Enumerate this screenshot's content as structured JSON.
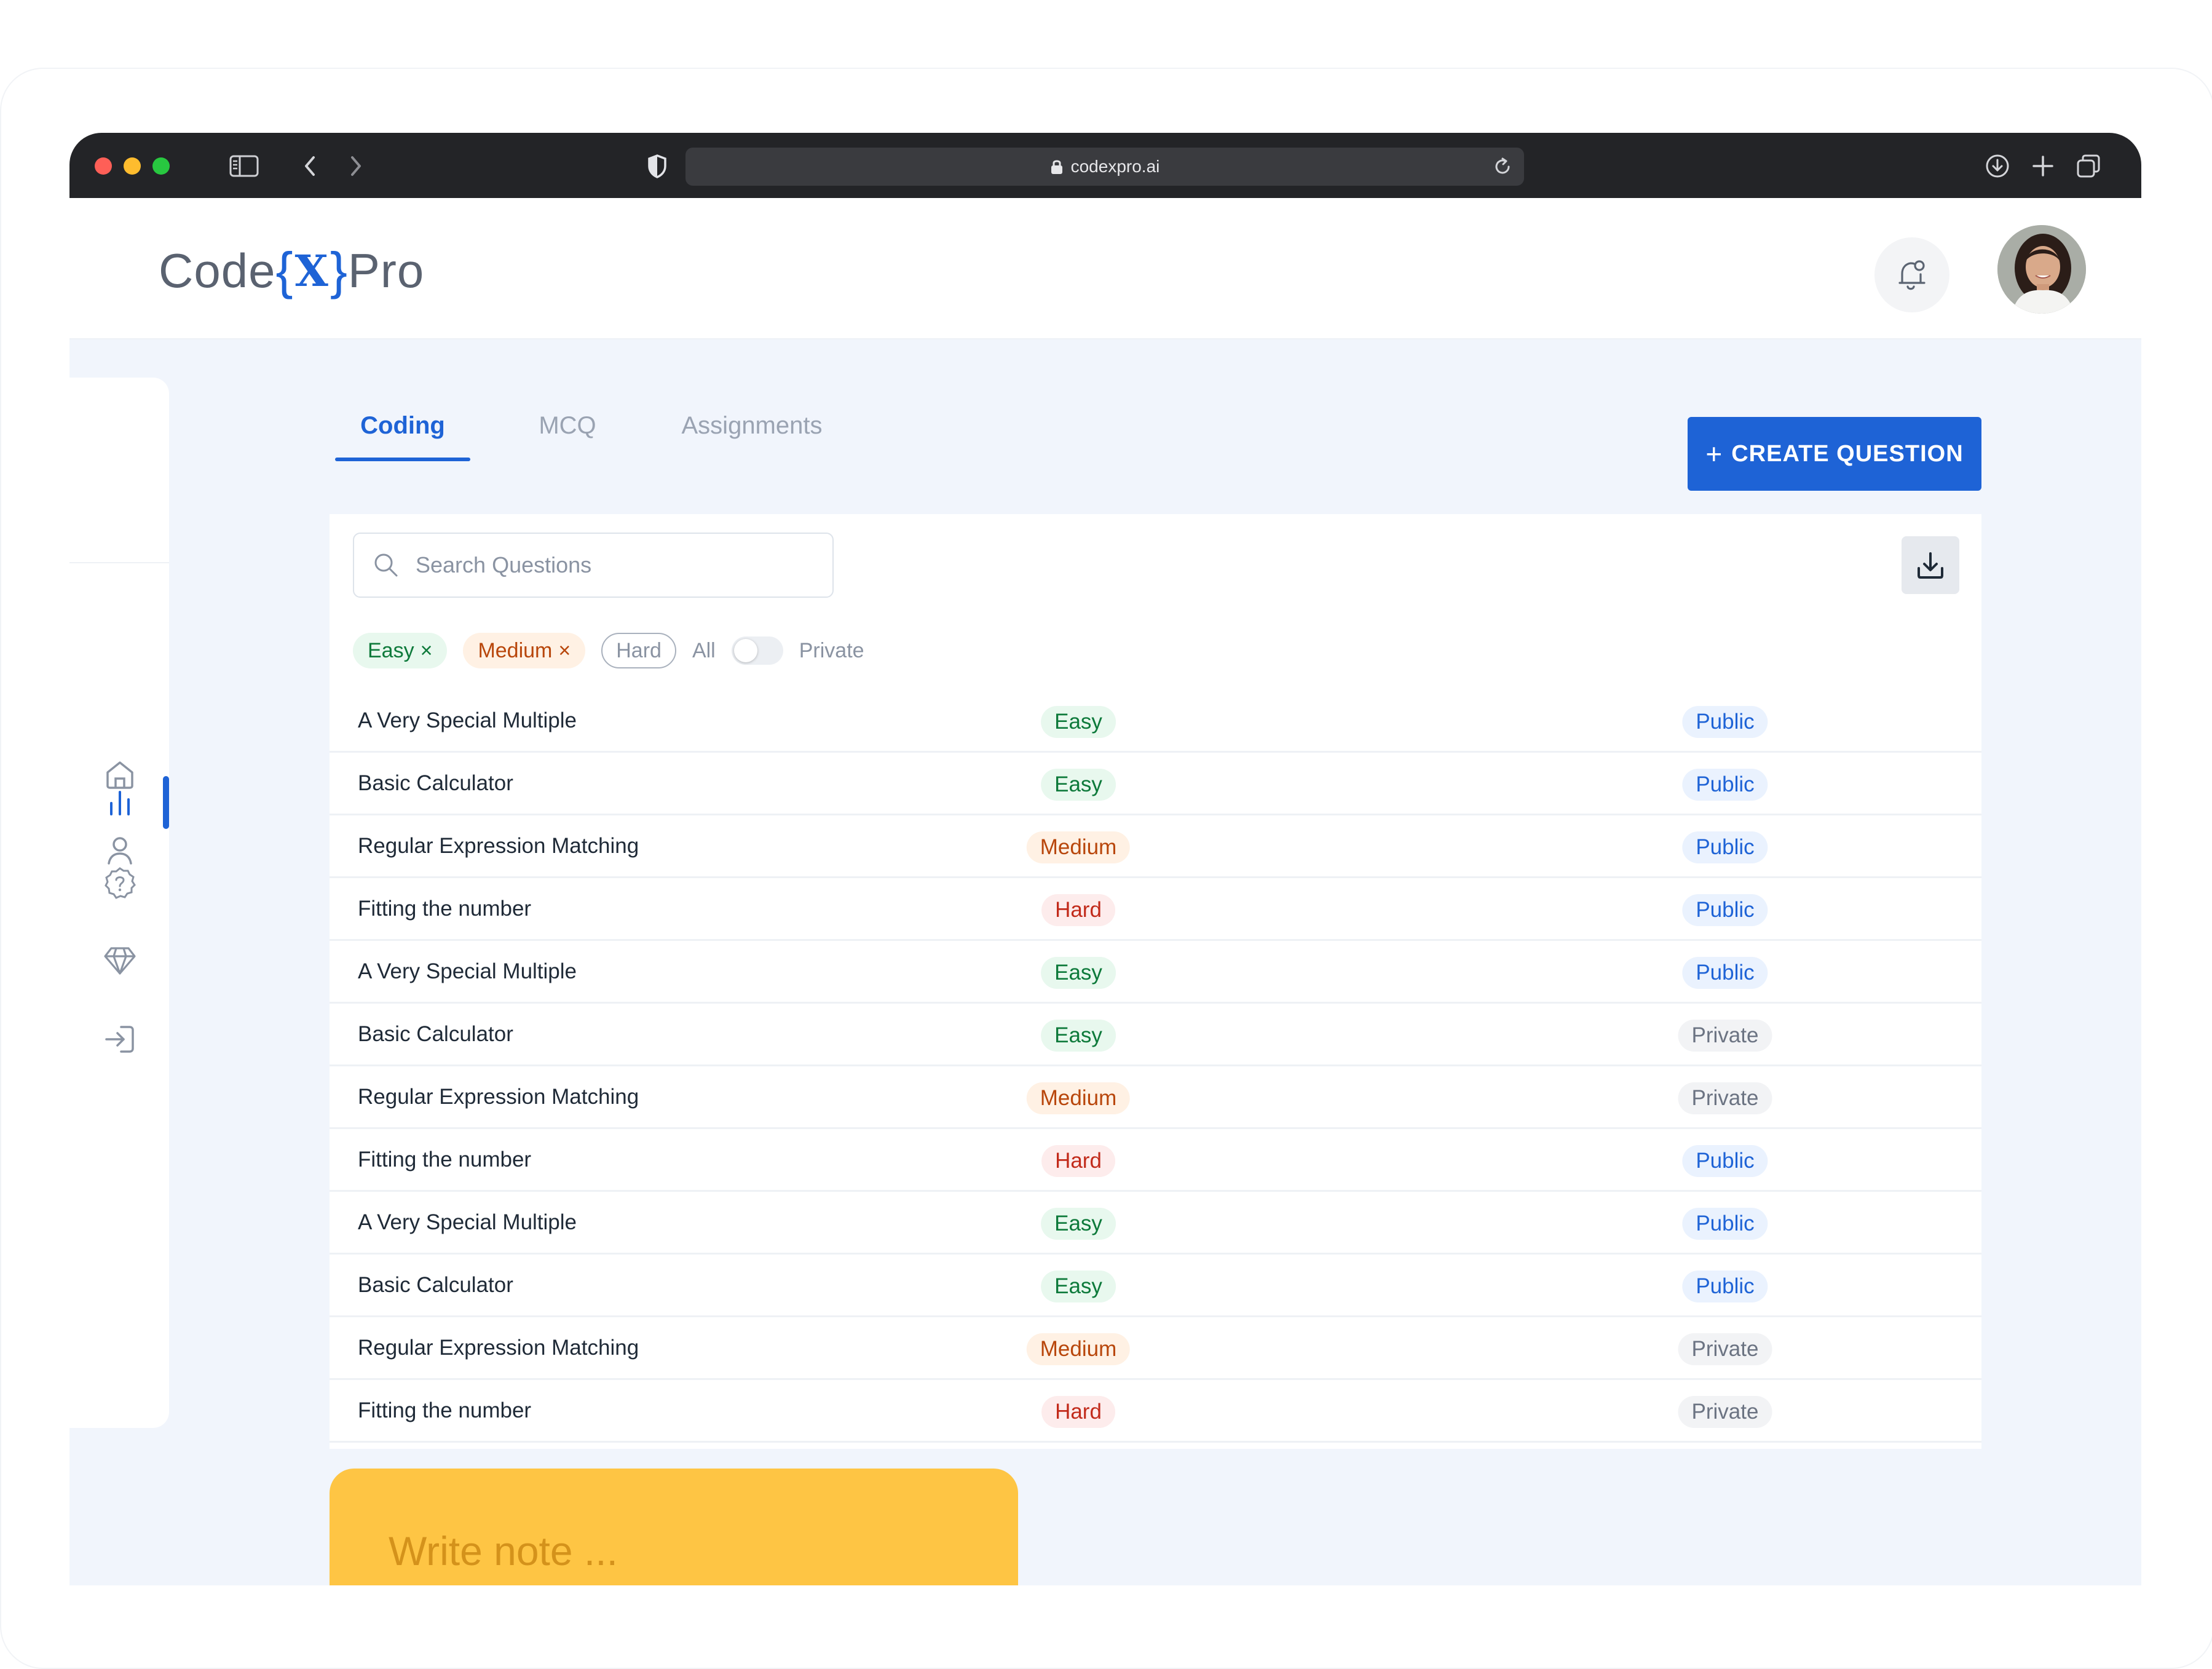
{
  "browser": {
    "url": "codexpro.ai"
  },
  "logo": {
    "prefix": "Code",
    "brace_open": "{",
    "mark": "X",
    "brace_close": "}",
    "suffix": "Pro"
  },
  "sidebar": {
    "icons": [
      "home-icon",
      "user-icon",
      "chart-icon",
      "help-icon",
      "diamond-icon",
      "logout-icon"
    ],
    "active": "chart-icon"
  },
  "tabs": [
    {
      "label": "Coding",
      "active": true
    },
    {
      "label": "MCQ",
      "active": false
    },
    {
      "label": "Assignments",
      "active": false
    }
  ],
  "actions": {
    "create_plus": "+",
    "create_label": "CREATE QUESTION"
  },
  "search": {
    "placeholder": "Search Questions",
    "value": ""
  },
  "filters": {
    "easy": "Easy",
    "medium": "Medium",
    "hard": "Hard",
    "remove_symbol": "×",
    "all": "All",
    "private": "Private",
    "private_toggle_on": false
  },
  "questions": [
    {
      "title": "A Very Special Multiple",
      "difficulty": "Easy",
      "visibility": "Public"
    },
    {
      "title": "Basic Calculator",
      "difficulty": "Easy",
      "visibility": "Public"
    },
    {
      "title": "Regular Expression Matching",
      "difficulty": "Medium",
      "visibility": "Public"
    },
    {
      "title": "Fitting the number",
      "difficulty": "Hard",
      "visibility": "Public"
    },
    {
      "title": "A Very Special Multiple",
      "difficulty": "Easy",
      "visibility": "Public"
    },
    {
      "title": "Basic Calculator",
      "difficulty": "Easy",
      "visibility": "Private"
    },
    {
      "title": "Regular Expression Matching",
      "difficulty": "Medium",
      "visibility": "Private"
    },
    {
      "title": "Fitting the number",
      "difficulty": "Hard",
      "visibility": "Public"
    },
    {
      "title": "A Very Special Multiple",
      "difficulty": "Easy",
      "visibility": "Public"
    },
    {
      "title": "Basic Calculator",
      "difficulty": "Easy",
      "visibility": "Public"
    },
    {
      "title": "Regular Expression Matching",
      "difficulty": "Medium",
      "visibility": "Private"
    },
    {
      "title": "Fitting the number",
      "difficulty": "Hard",
      "visibility": "Private"
    }
  ],
  "note": {
    "placeholder": "Write note ..."
  },
  "colors": {
    "accent": "#1e63d6",
    "note": "#fec544",
    "page_bg": "#f1f5fc"
  }
}
